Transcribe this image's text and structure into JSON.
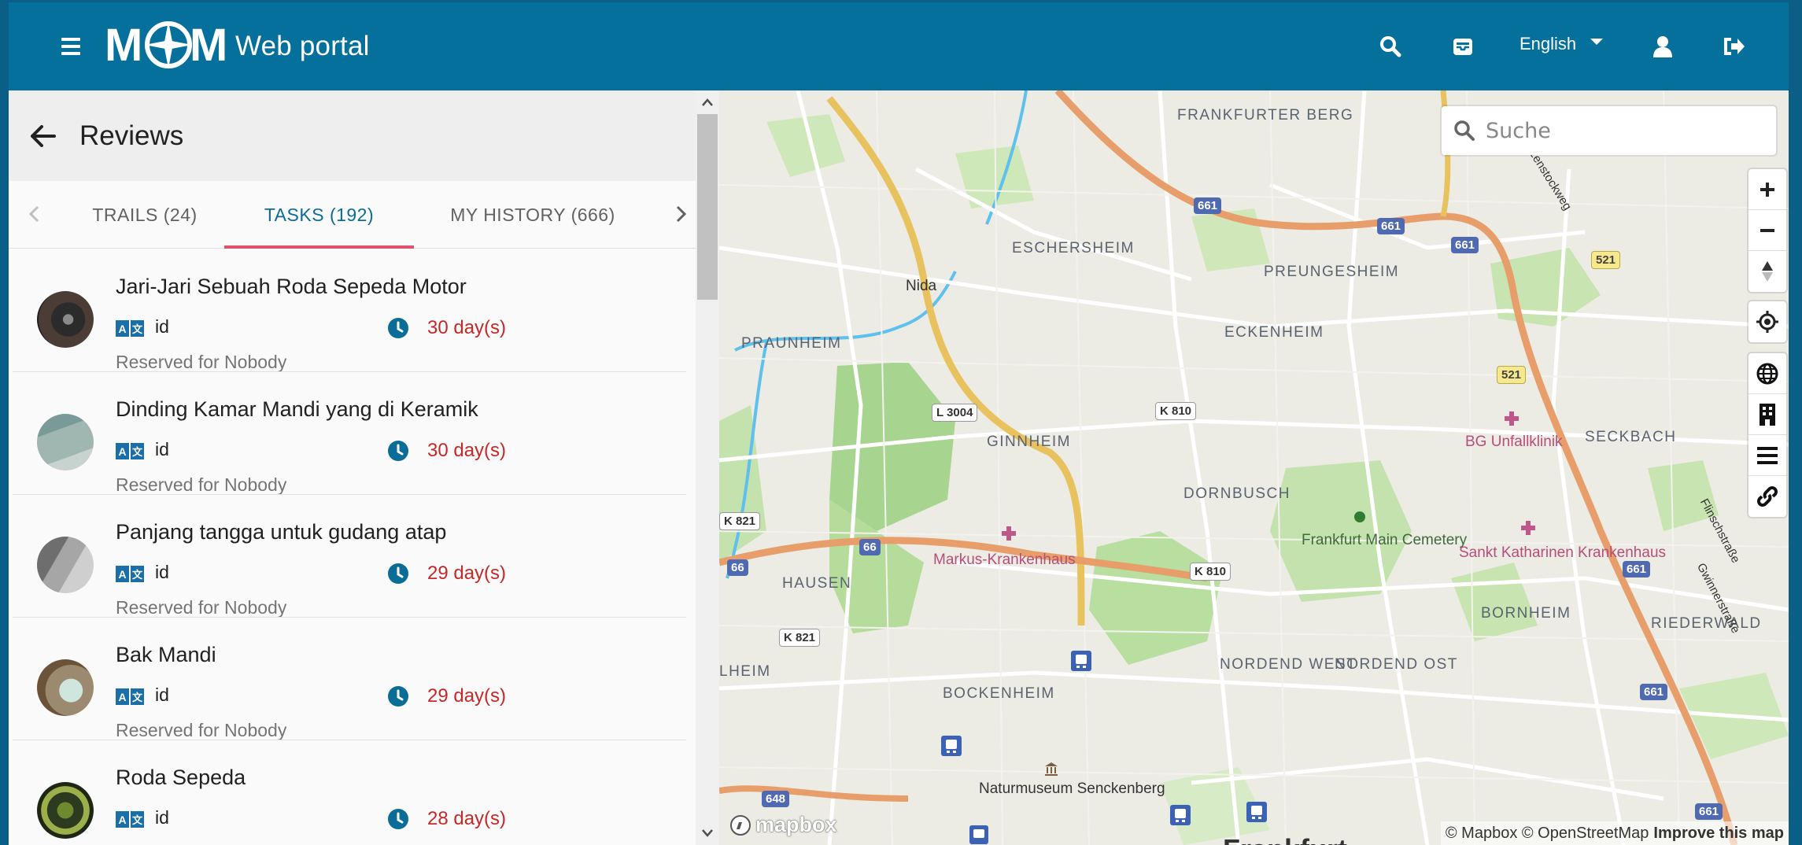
{
  "header": {
    "logo_text": "Web portal",
    "language": "English",
    "icons": [
      "menu-icon",
      "search-icon",
      "inbox-icon",
      "user-icon",
      "logout-icon"
    ],
    "brand_color": "#06709c"
  },
  "panel": {
    "title": "Reviews",
    "tabs": [
      {
        "label": "TRAILS (24)"
      },
      {
        "label": "TASKS (192)"
      },
      {
        "label": "MY HISTORY (666)"
      }
    ],
    "active_tab": "TASKS (192)",
    "items": [
      {
        "title": "Jari-Jari Sebuah Roda Sepeda Motor",
        "lang": "id",
        "days": "30 day(s)",
        "reserved": "Reserved for Nobody"
      },
      {
        "title": "Dinding Kamar Mandi yang di Keramik",
        "lang": "id",
        "days": "30 day(s)",
        "reserved": "Reserved for Nobody"
      },
      {
        "title": "Panjang tangga untuk gudang atap",
        "lang": "id",
        "days": "29 day(s)",
        "reserved": "Reserved for Nobody"
      },
      {
        "title": "Bak Mandi",
        "lang": "id",
        "days": "29 day(s)",
        "reserved": "Reserved for Nobody"
      },
      {
        "title": "Roda Sepeda",
        "lang": "id",
        "days": "28 day(s)",
        "reserved": ""
      }
    ]
  },
  "map": {
    "search_placeholder": "Suche",
    "labels": {
      "frankfurter_berg": "FRANKFURTER BERG",
      "eschersheim": "ESCHERSHEIM",
      "preungesheim": "PREUNGESHEIM",
      "nida": "Nida",
      "praunheim": "PRAUNHEIM",
      "eckenheim": "ECKENHEIM",
      "ginnheim": "GINNHEIM",
      "bg_unfallklinik": "BG Unfallklinik",
      "seckbach": "SECKBACH",
      "dornbusch": "DORNBUSCH",
      "frankfurt_main_cemetery": "Frankfurt Main Cemetery",
      "markus_krankenhaus": "Markus-Krankenhaus",
      "sankt_katharinen": "Sankt Katharinen Krankenhaus",
      "hausen": "HAUSEN",
      "bornheim": "BORNHEIM",
      "riederwald": "RIEDERWALD",
      "nordend_west": "NORDEND WEST",
      "nordend_ost": "NORDEND OST",
      "lheim": "LHEIM",
      "bockenheim": "BOCKENHEIM",
      "naturmuseum": "Naturmuseum Senckenberg",
      "frankfurt": "Frankfurt",
      "gwinnerstrasse": "Gwinnerstraße",
      "finkenstrasse": "Flinschstraße",
      "lenstockweg": "Lenstockweg"
    },
    "shields": {
      "a661_a": "661",
      "a661_b": "661",
      "a661_c": "661",
      "a661_d": "661",
      "a661_e": "661",
      "a661_f": "661",
      "b521_a": "521",
      "b521_b": "521",
      "l3004": "L 3004",
      "k810_a": "K 810",
      "k810_b": "K 810",
      "k821_a": "K 821",
      "k821_b": "K 821",
      "a66_a": "66",
      "a66_b": "66",
      "a648": "648"
    },
    "attribution": "© Mapbox © OpenStreetMap",
    "improve": "Improve this map",
    "mapbox_logo": "mapbox"
  }
}
